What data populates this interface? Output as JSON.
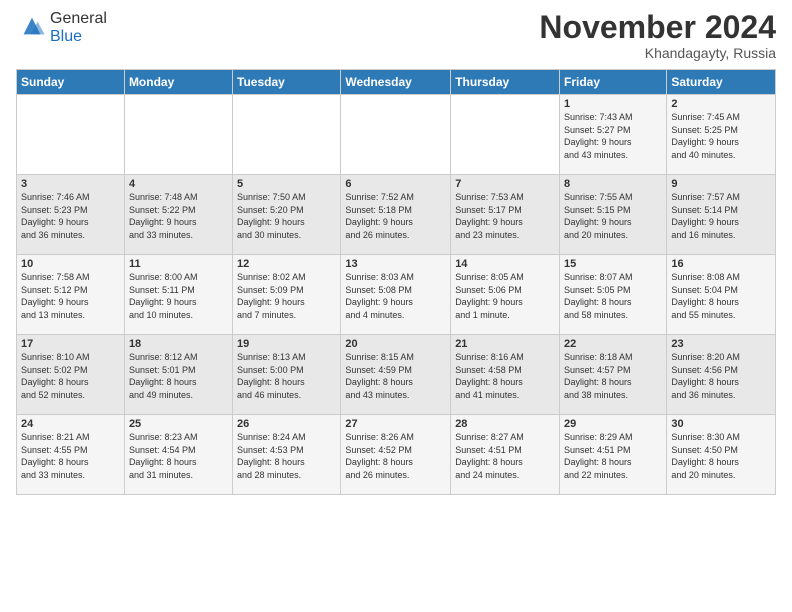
{
  "header": {
    "logo_general": "General",
    "logo_blue": "Blue",
    "month_title": "November 2024",
    "location": "Khandagayty, Russia"
  },
  "columns": [
    "Sunday",
    "Monday",
    "Tuesday",
    "Wednesday",
    "Thursday",
    "Friday",
    "Saturday"
  ],
  "weeks": [
    [
      {
        "day": "",
        "info": ""
      },
      {
        "day": "",
        "info": ""
      },
      {
        "day": "",
        "info": ""
      },
      {
        "day": "",
        "info": ""
      },
      {
        "day": "",
        "info": ""
      },
      {
        "day": "1",
        "info": "Sunrise: 7:43 AM\nSunset: 5:27 PM\nDaylight: 9 hours\nand 43 minutes."
      },
      {
        "day": "2",
        "info": "Sunrise: 7:45 AM\nSunset: 5:25 PM\nDaylight: 9 hours\nand 40 minutes."
      }
    ],
    [
      {
        "day": "3",
        "info": "Sunrise: 7:46 AM\nSunset: 5:23 PM\nDaylight: 9 hours\nand 36 minutes."
      },
      {
        "day": "4",
        "info": "Sunrise: 7:48 AM\nSunset: 5:22 PM\nDaylight: 9 hours\nand 33 minutes."
      },
      {
        "day": "5",
        "info": "Sunrise: 7:50 AM\nSunset: 5:20 PM\nDaylight: 9 hours\nand 30 minutes."
      },
      {
        "day": "6",
        "info": "Sunrise: 7:52 AM\nSunset: 5:18 PM\nDaylight: 9 hours\nand 26 minutes."
      },
      {
        "day": "7",
        "info": "Sunrise: 7:53 AM\nSunset: 5:17 PM\nDaylight: 9 hours\nand 23 minutes."
      },
      {
        "day": "8",
        "info": "Sunrise: 7:55 AM\nSunset: 5:15 PM\nDaylight: 9 hours\nand 20 minutes."
      },
      {
        "day": "9",
        "info": "Sunrise: 7:57 AM\nSunset: 5:14 PM\nDaylight: 9 hours\nand 16 minutes."
      }
    ],
    [
      {
        "day": "10",
        "info": "Sunrise: 7:58 AM\nSunset: 5:12 PM\nDaylight: 9 hours\nand 13 minutes."
      },
      {
        "day": "11",
        "info": "Sunrise: 8:00 AM\nSunset: 5:11 PM\nDaylight: 9 hours\nand 10 minutes."
      },
      {
        "day": "12",
        "info": "Sunrise: 8:02 AM\nSunset: 5:09 PM\nDaylight: 9 hours\nand 7 minutes."
      },
      {
        "day": "13",
        "info": "Sunrise: 8:03 AM\nSunset: 5:08 PM\nDaylight: 9 hours\nand 4 minutes."
      },
      {
        "day": "14",
        "info": "Sunrise: 8:05 AM\nSunset: 5:06 PM\nDaylight: 9 hours\nand 1 minute."
      },
      {
        "day": "15",
        "info": "Sunrise: 8:07 AM\nSunset: 5:05 PM\nDaylight: 8 hours\nand 58 minutes."
      },
      {
        "day": "16",
        "info": "Sunrise: 8:08 AM\nSunset: 5:04 PM\nDaylight: 8 hours\nand 55 minutes."
      }
    ],
    [
      {
        "day": "17",
        "info": "Sunrise: 8:10 AM\nSunset: 5:02 PM\nDaylight: 8 hours\nand 52 minutes."
      },
      {
        "day": "18",
        "info": "Sunrise: 8:12 AM\nSunset: 5:01 PM\nDaylight: 8 hours\nand 49 minutes."
      },
      {
        "day": "19",
        "info": "Sunrise: 8:13 AM\nSunset: 5:00 PM\nDaylight: 8 hours\nand 46 minutes."
      },
      {
        "day": "20",
        "info": "Sunrise: 8:15 AM\nSunset: 4:59 PM\nDaylight: 8 hours\nand 43 minutes."
      },
      {
        "day": "21",
        "info": "Sunrise: 8:16 AM\nSunset: 4:58 PM\nDaylight: 8 hours\nand 41 minutes."
      },
      {
        "day": "22",
        "info": "Sunrise: 8:18 AM\nSunset: 4:57 PM\nDaylight: 8 hours\nand 38 minutes."
      },
      {
        "day": "23",
        "info": "Sunrise: 8:20 AM\nSunset: 4:56 PM\nDaylight: 8 hours\nand 36 minutes."
      }
    ],
    [
      {
        "day": "24",
        "info": "Sunrise: 8:21 AM\nSunset: 4:55 PM\nDaylight: 8 hours\nand 33 minutes."
      },
      {
        "day": "25",
        "info": "Sunrise: 8:23 AM\nSunset: 4:54 PM\nDaylight: 8 hours\nand 31 minutes."
      },
      {
        "day": "26",
        "info": "Sunrise: 8:24 AM\nSunset: 4:53 PM\nDaylight: 8 hours\nand 28 minutes."
      },
      {
        "day": "27",
        "info": "Sunrise: 8:26 AM\nSunset: 4:52 PM\nDaylight: 8 hours\nand 26 minutes."
      },
      {
        "day": "28",
        "info": "Sunrise: 8:27 AM\nSunset: 4:51 PM\nDaylight: 8 hours\nand 24 minutes."
      },
      {
        "day": "29",
        "info": "Sunrise: 8:29 AM\nSunset: 4:51 PM\nDaylight: 8 hours\nand 22 minutes."
      },
      {
        "day": "30",
        "info": "Sunrise: 8:30 AM\nSunset: 4:50 PM\nDaylight: 8 hours\nand 20 minutes."
      }
    ]
  ]
}
